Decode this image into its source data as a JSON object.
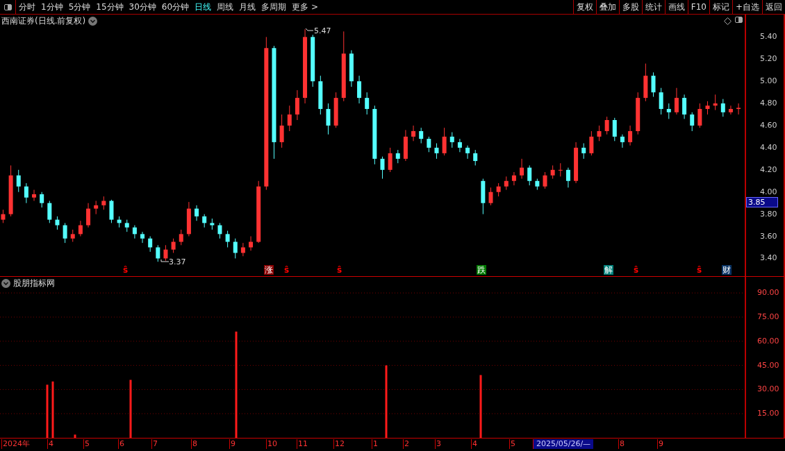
{
  "toolbar": {
    "periods": [
      {
        "label": "分时",
        "selected": false
      },
      {
        "label": "1分钟",
        "selected": false
      },
      {
        "label": "5分钟",
        "selected": false
      },
      {
        "label": "15分钟",
        "selected": false
      },
      {
        "label": "30分钟",
        "selected": false
      },
      {
        "label": "60分钟",
        "selected": false
      },
      {
        "label": "日线",
        "selected": true
      },
      {
        "label": "周线",
        "selected": false
      },
      {
        "label": "月线",
        "selected": false
      },
      {
        "label": "多周期",
        "selected": false
      },
      {
        "label": "更多 >",
        "selected": false
      }
    ],
    "actions": [
      "复权",
      "叠加",
      "多股",
      "统计",
      "画线",
      "F10",
      "标记",
      "+自选",
      "返回"
    ]
  },
  "main_chart": {
    "title": "西南证券(日线.前复权)",
    "high_label": "5.47",
    "low_label": "3.37",
    "current_price": "3.85",
    "chart_data": {
      "type": "candlestick",
      "ylim": [
        3.24,
        5.59
      ],
      "categories": [
        null,
        null,
        null,
        null,
        null,
        null,
        null,
        null,
        null,
        null,
        null,
        null,
        null,
        null,
        null,
        null,
        null,
        null,
        null,
        null,
        null,
        null,
        null,
        null,
        null,
        null,
        null,
        null,
        null,
        null,
        null,
        null,
        null,
        null,
        null,
        null,
        null,
        null,
        null,
        null,
        null,
        null,
        null,
        null,
        null,
        null,
        null,
        null,
        null,
        null,
        null,
        null,
        null,
        null,
        null,
        null,
        null,
        null,
        null,
        null,
        null,
        null,
        null,
        null,
        null,
        null,
        null,
        null,
        null,
        null,
        null,
        null,
        null,
        null,
        null,
        null,
        null,
        null,
        null,
        null,
        null,
        null,
        null,
        null,
        null,
        null,
        null,
        null,
        null,
        null,
        null,
        null,
        null,
        null,
        null,
        null
      ],
      "ohlc": [
        [
          3.75,
          3.84,
          3.72,
          3.8
        ],
        [
          3.8,
          4.24,
          3.78,
          4.15
        ],
        [
          4.15,
          4.2,
          4.0,
          4.05
        ],
        [
          4.05,
          4.08,
          3.9,
          3.95
        ],
        [
          3.95,
          4.02,
          3.92,
          3.98
        ],
        [
          3.98,
          4.0,
          3.86,
          3.9
        ],
        [
          3.9,
          3.92,
          3.72,
          3.75
        ],
        [
          3.75,
          3.78,
          3.66,
          3.7
        ],
        [
          3.7,
          3.72,
          3.54,
          3.58
        ],
        [
          3.58,
          3.66,
          3.55,
          3.62
        ],
        [
          3.62,
          3.74,
          3.6,
          3.7
        ],
        [
          3.7,
          3.9,
          3.68,
          3.85
        ],
        [
          3.85,
          3.92,
          3.8,
          3.88
        ],
        [
          3.88,
          3.96,
          3.84,
          3.92
        ],
        [
          3.92,
          3.93,
          3.72,
          3.75
        ],
        [
          3.75,
          3.78,
          3.68,
          3.72
        ],
        [
          3.72,
          3.75,
          3.64,
          3.68
        ],
        [
          3.68,
          3.7,
          3.58,
          3.62
        ],
        [
          3.62,
          3.64,
          3.54,
          3.58
        ],
        [
          3.58,
          3.6,
          3.46,
          3.5
        ],
        [
          3.5,
          3.52,
          3.37,
          3.4
        ],
        [
          3.4,
          3.52,
          3.38,
          3.48
        ],
        [
          3.48,
          3.58,
          3.45,
          3.55
        ],
        [
          3.55,
          3.66,
          3.52,
          3.62
        ],
        [
          3.62,
          3.91,
          3.6,
          3.85
        ],
        [
          3.85,
          3.88,
          3.74,
          3.78
        ],
        [
          3.78,
          3.8,
          3.68,
          3.72
        ],
        [
          3.72,
          3.76,
          3.66,
          3.7
        ],
        [
          3.7,
          3.72,
          3.58,
          3.62
        ],
        [
          3.62,
          3.65,
          3.5,
          3.55
        ],
        [
          3.55,
          3.58,
          3.4,
          3.45
        ],
        [
          3.45,
          3.54,
          3.42,
          3.5
        ],
        [
          3.5,
          3.6,
          3.47,
          3.55
        ],
        [
          3.55,
          4.1,
          3.54,
          4.05
        ],
        [
          4.05,
          5.4,
          4.02,
          5.3
        ],
        [
          5.3,
          5.32,
          4.3,
          4.45
        ],
        [
          4.45,
          4.7,
          4.4,
          4.6
        ],
        [
          4.6,
          4.78,
          4.55,
          4.7
        ],
        [
          4.7,
          4.92,
          4.65,
          4.85
        ],
        [
          4.85,
          5.47,
          4.8,
          5.4
        ],
        [
          5.4,
          5.42,
          4.95,
          5.0
        ],
        [
          5.0,
          5.05,
          4.7,
          4.75
        ],
        [
          4.75,
          4.8,
          4.52,
          4.6
        ],
        [
          4.6,
          4.9,
          4.58,
          4.85
        ],
        [
          4.85,
          5.45,
          4.82,
          5.25
        ],
        [
          5.25,
          5.28,
          4.95,
          5.0
        ],
        [
          5.0,
          5.05,
          4.8,
          4.85
        ],
        [
          4.85,
          4.9,
          4.7,
          4.75
        ],
        [
          4.75,
          4.78,
          4.25,
          4.3
        ],
        [
          4.3,
          4.32,
          4.12,
          4.2
        ],
        [
          4.2,
          4.4,
          4.18,
          4.35
        ],
        [
          4.35,
          4.38,
          4.26,
          4.3
        ],
        [
          4.3,
          4.56,
          4.28,
          4.5
        ],
        [
          4.5,
          4.6,
          4.46,
          4.55
        ],
        [
          4.55,
          4.58,
          4.44,
          4.48
        ],
        [
          4.48,
          4.5,
          4.36,
          4.4
        ],
        [
          4.4,
          4.44,
          4.3,
          4.35
        ],
        [
          4.35,
          4.58,
          4.33,
          4.5
        ],
        [
          4.5,
          4.54,
          4.4,
          4.45
        ],
        [
          4.45,
          4.48,
          4.36,
          4.4
        ],
        [
          4.4,
          4.42,
          4.3,
          4.35
        ],
        [
          4.35,
          4.38,
          4.24,
          4.28
        ],
        [
          4.1,
          4.12,
          3.8,
          3.9
        ],
        [
          3.9,
          4.04,
          3.88,
          4.0
        ],
        [
          4.0,
          4.08,
          3.96,
          4.05
        ],
        [
          4.05,
          4.14,
          4.02,
          4.1
        ],
        [
          4.1,
          4.18,
          4.06,
          4.15
        ],
        [
          4.15,
          4.3,
          4.12,
          4.22
        ],
        [
          4.22,
          4.24,
          4.06,
          4.1
        ],
        [
          4.1,
          4.12,
          4.02,
          4.05
        ],
        [
          4.05,
          4.18,
          4.03,
          4.15
        ],
        [
          4.15,
          4.24,
          4.12,
          4.2
        ],
        [
          4.2,
          4.26,
          4.14,
          4.2
        ],
        [
          4.2,
          4.22,
          4.04,
          4.1
        ],
        [
          4.1,
          4.45,
          4.08,
          4.4
        ],
        [
          4.4,
          4.44,
          4.3,
          4.35
        ],
        [
          4.35,
          4.55,
          4.33,
          4.5
        ],
        [
          4.5,
          4.6,
          4.46,
          4.55
        ],
        [
          4.55,
          4.68,
          4.52,
          4.65
        ],
        [
          4.65,
          4.67,
          4.46,
          4.5
        ],
        [
          4.5,
          4.52,
          4.4,
          4.45
        ],
        [
          4.45,
          4.6,
          4.42,
          4.55
        ],
        [
          4.55,
          4.9,
          4.52,
          4.85
        ],
        [
          4.85,
          5.16,
          4.82,
          5.05
        ],
        [
          5.05,
          5.08,
          4.86,
          4.9
        ],
        [
          4.9,
          4.94,
          4.7,
          4.75
        ],
        [
          4.75,
          4.8,
          4.66,
          4.72
        ],
        [
          4.72,
          4.94,
          4.7,
          4.85
        ],
        [
          4.85,
          4.88,
          4.66,
          4.7
        ],
        [
          4.7,
          4.72,
          4.55,
          4.6
        ],
        [
          4.6,
          4.8,
          4.58,
          4.75
        ],
        [
          4.75,
          4.82,
          4.7,
          4.78
        ],
        [
          4.78,
          4.88,
          4.74,
          4.8
        ],
        [
          4.8,
          4.84,
          4.68,
          4.72
        ],
        [
          4.72,
          4.78,
          4.7,
          4.75
        ],
        [
          4.75,
          4.8,
          4.7,
          4.76
        ]
      ],
      "yticks": [
        {
          "value": 5.4,
          "label": "5.40"
        },
        {
          "value": 5.2,
          "label": "5.20"
        },
        {
          "value": 5.0,
          "label": "5.00"
        },
        {
          "value": 4.8,
          "label": "4.80"
        },
        {
          "value": 4.6,
          "label": "4.60"
        },
        {
          "value": 4.4,
          "label": "4.40"
        },
        {
          "value": 4.2,
          "label": "4.20"
        },
        {
          "value": 4.0,
          "label": "4.00"
        },
        {
          "value": 3.8,
          "label": "3.80"
        },
        {
          "value": 3.6,
          "label": "3.60"
        },
        {
          "value": 3.4,
          "label": "3.40"
        }
      ]
    },
    "markers": [
      {
        "kind": "dollar",
        "text": "ŝ"
      },
      {
        "kind": "tag",
        "text": "涨",
        "color": "#8b0000"
      },
      {
        "kind": "dollar",
        "text": "ŝ"
      },
      {
        "kind": "dollar",
        "text": "ŝ"
      },
      {
        "kind": "tag",
        "text": "跌",
        "color": "#007a00"
      },
      {
        "kind": "tag",
        "text": "解",
        "color": "#00807a"
      },
      {
        "kind": "dollar",
        "text": "ŝ"
      },
      {
        "kind": "dollar",
        "text": "ŝ"
      },
      {
        "kind": "tag",
        "text": "财",
        "color": "#0b3566"
      }
    ]
  },
  "indicator": {
    "title": "股朋指标网",
    "chart_data": {
      "type": "bar",
      "ylim": [
        0,
        100
      ],
      "grid": true,
      "categories": [
        null,
        null,
        null,
        null,
        null,
        null,
        null,
        null,
        null,
        null,
        null,
        null,
        null,
        null,
        null,
        null,
        null,
        null,
        null,
        null,
        null,
        null,
        null,
        null,
        null,
        null,
        null,
        null,
        null,
        null,
        null,
        null,
        null,
        null,
        null,
        null,
        null,
        null,
        null,
        null,
        null,
        null,
        null,
        null,
        null,
        null,
        null,
        null,
        null,
        null,
        null,
        null,
        null,
        null,
        null,
        null,
        null,
        null,
        null,
        null,
        null,
        null,
        null,
        null,
        null,
        null,
        null,
        null,
        null,
        null,
        null,
        null,
        null,
        null,
        null,
        null,
        null,
        null,
        null,
        null,
        null,
        null,
        null,
        null,
        null,
        null,
        null,
        null,
        null,
        null,
        null,
        null,
        null,
        null,
        null,
        null,
        null,
        null,
        null,
        null,
        null,
        null,
        null,
        null,
        null,
        null,
        null,
        null,
        null,
        null,
        null,
        null,
        null,
        null,
        null,
        null,
        null,
        null,
        null,
        null,
        null,
        null,
        null,
        null,
        null,
        null,
        null,
        null,
        null,
        null,
        null,
        null,
        null,
        null
      ],
      "values": [
        null,
        null,
        null,
        null,
        null,
        null,
        null,
        null,
        33,
        35,
        null,
        null,
        null,
        2,
        null,
        null,
        null,
        null,
        null,
        null,
        null,
        null,
        null,
        36,
        null,
        null,
        null,
        null,
        null,
        null,
        null,
        null,
        null,
        null,
        null,
        null,
        null,
        null,
        null,
        null,
        null,
        null,
        66,
        null,
        null,
        null,
        null,
        null,
        null,
        null,
        null,
        null,
        null,
        null,
        null,
        null,
        null,
        null,
        null,
        null,
        null,
        null,
        null,
        null,
        null,
        null,
        null,
        null,
        null,
        45,
        null,
        null,
        null,
        null,
        null,
        null,
        null,
        null,
        null,
        null,
        null,
        null,
        null,
        null,
        null,
        null,
        39,
        null,
        null,
        null,
        null,
        null,
        null,
        null,
        null,
        null,
        null,
        null,
        null,
        null,
        null,
        null,
        null,
        null,
        null,
        null,
        null,
        null,
        null,
        null,
        null,
        null,
        null,
        null,
        null,
        null,
        null,
        null,
        null,
        null,
        null,
        null,
        null,
        null,
        null,
        null,
        null,
        null,
        null,
        null,
        null,
        null,
        null,
        null
      ],
      "yticks": [
        {
          "value": 90,
          "label": "90.00"
        },
        {
          "value": 75,
          "label": "75.00"
        },
        {
          "value": 60,
          "label": "60.00"
        },
        {
          "value": 45,
          "label": "45.00"
        },
        {
          "value": 30,
          "label": "30.00"
        },
        {
          "value": 15,
          "label": "15.00"
        }
      ]
    }
  },
  "time_axis": [
    {
      "label": "2024年",
      "highlighted": false
    },
    {
      "label": "4",
      "highlighted": false
    },
    {
      "label": "5",
      "highlighted": false
    },
    {
      "label": "6",
      "highlighted": false
    },
    {
      "label": "7",
      "highlighted": false
    },
    {
      "label": "8",
      "highlighted": false
    },
    {
      "label": "9",
      "highlighted": false
    },
    {
      "label": "10",
      "highlighted": false
    },
    {
      "label": "11",
      "highlighted": false
    },
    {
      "label": "12",
      "highlighted": false
    },
    {
      "label": "1",
      "highlighted": false
    },
    {
      "label": "2",
      "highlighted": false
    },
    {
      "label": "3",
      "highlighted": false
    },
    {
      "label": "4",
      "highlighted": false
    },
    {
      "label": "5",
      "highlighted": false
    },
    {
      "label": "2025/05/26/—",
      "highlighted": true
    },
    {
      "label": "8",
      "highlighted": false
    },
    {
      "label": "9",
      "highlighted": false
    }
  ]
}
